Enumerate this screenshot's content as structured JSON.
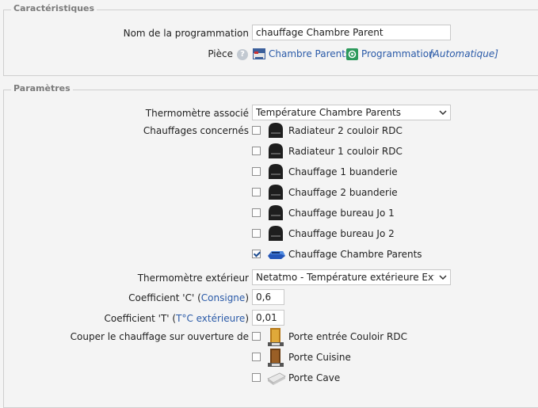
{
  "characteristics": {
    "legend": "Caractéristiques",
    "name_label": "Nom de la programmation",
    "name_value": "chauffage Chambre Parent",
    "piece_label": "Pièce",
    "help_symbol": "?",
    "room_link": "Chambre Parents",
    "program_link": "Programmation",
    "program_mode": "[Automatique]"
  },
  "parameters": {
    "legend": "Paramètres",
    "thermo_label": "Thermomètre associé",
    "thermo_value": "Température Chambre Parents",
    "heaters_label": "Chauffages concernés",
    "heaters": [
      {
        "label": "Radiateur 2 couloir RDC",
        "checked": false
      },
      {
        "label": "Radiateur 1 couloir RDC",
        "checked": false
      },
      {
        "label": "Chauffage 1 buanderie",
        "checked": false
      },
      {
        "label": "Chauffage 2 buanderie",
        "checked": false
      },
      {
        "label": "Chauffage bureau Jo 1",
        "checked": false
      },
      {
        "label": "Chauffage bureau Jo 2",
        "checked": false
      },
      {
        "label": "Chauffage Chambre Parents",
        "checked": true
      }
    ],
    "ext_thermo_label": "Thermomètre extérieur",
    "ext_thermo_value": "Netatmo - Température extérieure Extér",
    "coef_c_prefix": "Coefficient 'C' (",
    "coef_c_link": "Consigne",
    "coef_c_suffix": ")",
    "coef_c_value": "0,6",
    "coef_t_prefix": "Coefficient 'T' (",
    "coef_t_link": "T°C extérieure",
    "coef_t_suffix": ")",
    "coef_t_value": "0,01",
    "cut_label": "Couper le chauffage sur ouverture de",
    "doors": [
      {
        "label": "Porte entrée Couloir RDC",
        "checked": false,
        "icon": "door-sensor-icon"
      },
      {
        "label": "Porte Cuisine",
        "checked": false,
        "icon": "door-sensor-icon"
      },
      {
        "label": "Porte Cave",
        "checked": false,
        "icon": "contact-sensor-icon"
      }
    ]
  }
}
